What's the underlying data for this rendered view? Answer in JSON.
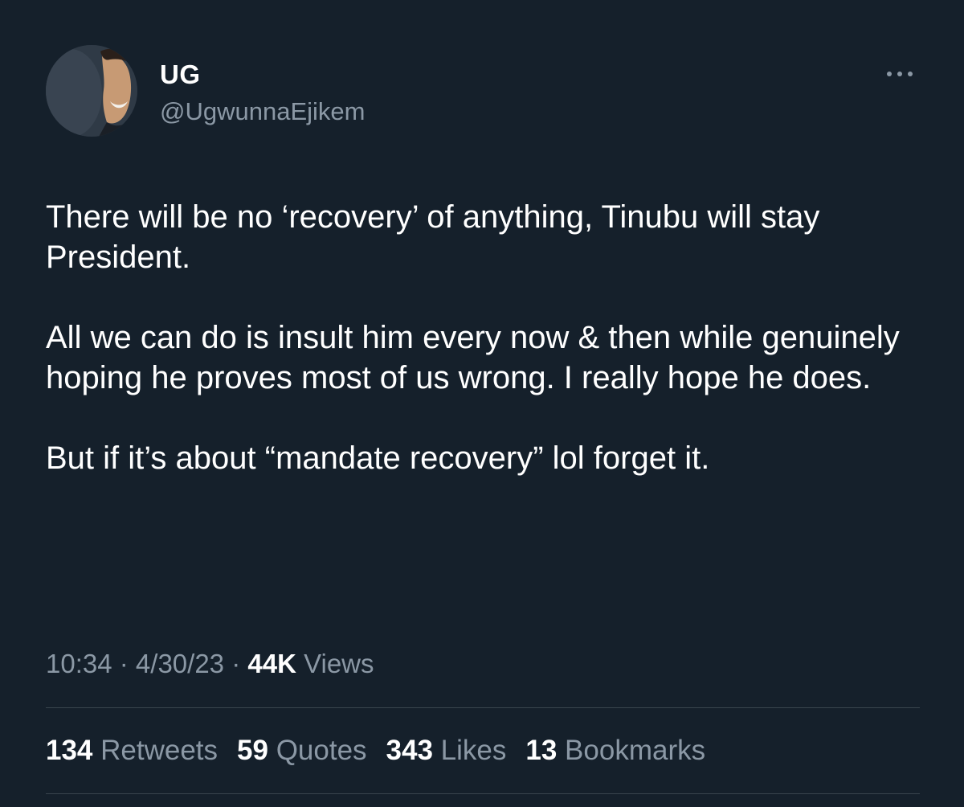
{
  "author": {
    "display_name": "UG",
    "handle": "@UgwunnaEjikem",
    "avatar_icon": "profile-photo"
  },
  "tweet": {
    "paragraphs": [
      "There will be no ‘recovery’ of anything, Tinubu will stay President.",
      "All we can do is insult him every now & then while genuinely hoping he proves most of us wrong. I really hope he does.",
      "But if it’s about “mandate recovery” lol forget it."
    ]
  },
  "meta": {
    "time": "10:34",
    "separator": " · ",
    "date": "4/30/23",
    "views_count": "44K",
    "views_label": " Views"
  },
  "stats": {
    "retweets_count": "134",
    "retweets_label": " Retweets",
    "quotes_count": "59",
    "quotes_label": " Quotes",
    "likes_count": "343",
    "likes_label": " Likes",
    "bookmarks_count": "13",
    "bookmarks_label": " Bookmarks"
  },
  "colors": {
    "background": "#15202b",
    "primary_text": "#ffffff",
    "secondary_text": "#8b98a5",
    "divider": "#38444d"
  },
  "more_icon": "more-horizontal-icon"
}
